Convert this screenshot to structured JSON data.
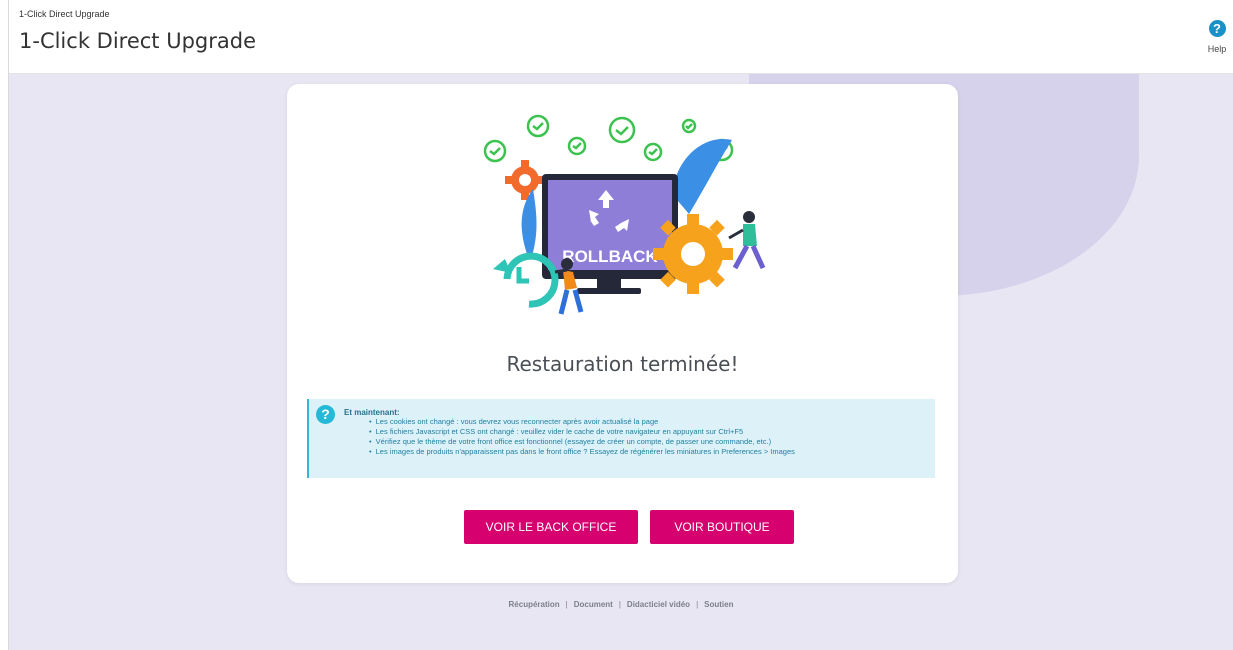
{
  "header": {
    "breadcrumb": "1-Click Direct Upgrade",
    "title": "1-Click Direct Upgrade",
    "help_label": "Help",
    "help_icon": "question-circle-icon"
  },
  "illustration": {
    "screen_text": "ROLLBACK"
  },
  "main": {
    "title": "Restauration terminée!"
  },
  "info": {
    "title": "Et maintenant:",
    "items": [
      "Les cookies ont changé : vous devrez vous reconnecter après avoir actualisé la page",
      "Les fichiers Javascript et CSS ont changé : veuillez vider le cache de votre navigateur en appuyant sur Ctrl+F5",
      "Vérifiez que le thème de votre front office est fonctionnel (essayez de créer un compte, de passer une commande, etc.)",
      "Les images de produits n'apparaissent pas dans le front office ? Essayez de régénérer les miniatures in Preferences > Images"
    ]
  },
  "buttons": {
    "back_office": "VOIR LE BACK OFFICE",
    "shop": "VOIR BOUTIQUE"
  },
  "footer": {
    "links": [
      "Récupération",
      "Document",
      "Didacticiel vidéo",
      "Soutien"
    ]
  },
  "colors": {
    "accent": "#d6006f",
    "info_bg": "#ddf2f8",
    "help_blue": "#1990c8",
    "page_bg": "#e8e6f3"
  }
}
